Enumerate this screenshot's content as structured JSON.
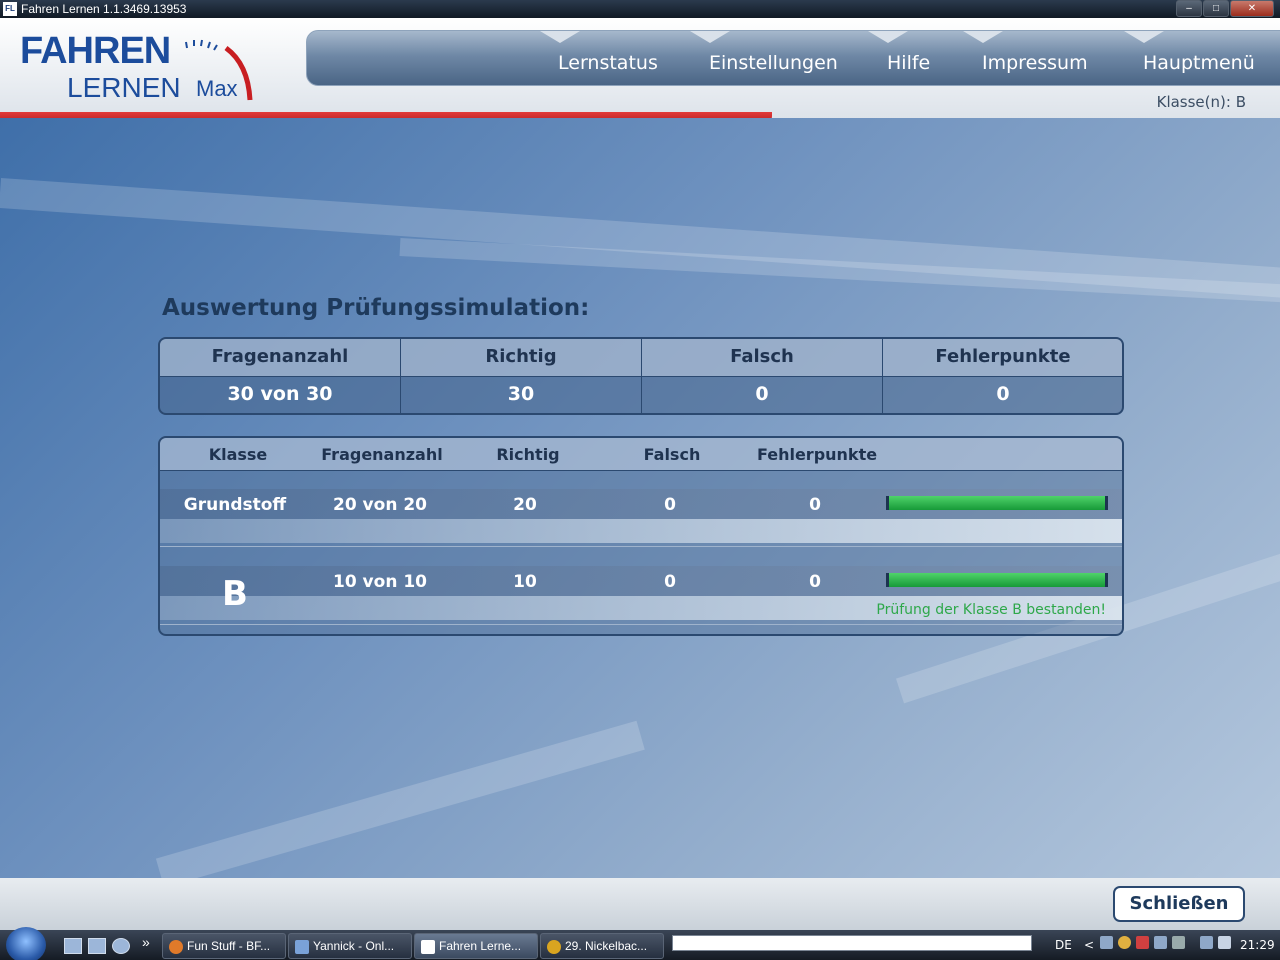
{
  "window": {
    "title": "Fahren Lernen 1.1.3469.13953",
    "app_icon": "FL"
  },
  "logo": {
    "line1": "FAHREN",
    "line2": "LERNEN",
    "line3": "Max"
  },
  "nav": {
    "items": [
      "Lernstatus",
      "Einstellungen",
      "Hilfe",
      "Impressum",
      "Hauptmenü"
    ],
    "klasse_label": "Klasse(n): B"
  },
  "result": {
    "heading": "Auswertung Prüfungssimulation:",
    "summary": {
      "headers": [
        "Fragenanzahl",
        "Richtig",
        "Falsch",
        "Fehlerpunkte"
      ],
      "values": [
        "30 von 30",
        "30",
        "0",
        "0"
      ]
    },
    "detail": {
      "headers": [
        "Klasse",
        "Fragenanzahl",
        "Richtig",
        "Falsch",
        "Fehlerpunkte"
      ],
      "rows": [
        {
          "klasse": "Grundstoff",
          "fragenanzahl": "20 von 20",
          "richtig": "20",
          "falsch": "0",
          "fehlerpunkte": "0",
          "progress": 1.0
        },
        {
          "klasse": "B",
          "fragenanzahl": "10 von 10",
          "richtig": "10",
          "falsch": "0",
          "fehlerpunkte": "0",
          "progress": 1.0
        }
      ],
      "passed_message": "Prüfung der Klasse B bestanden!"
    }
  },
  "footer": {
    "close_label": "Schließen"
  },
  "taskbar": {
    "overflow": "»",
    "tasks": [
      "Fun Stuff - BF...",
      "Yannick - Onl...",
      "Fahren Lerne...",
      "29. Nickelbac..."
    ],
    "language": "DE",
    "tray_chevron": "<",
    "clock": "21:29"
  },
  "colors": {
    "accent_red": "#c81e22",
    "brand_blue": "#1c4c9c",
    "progress_green": "#2bb34c",
    "pass_text": "#2ea84a"
  }
}
